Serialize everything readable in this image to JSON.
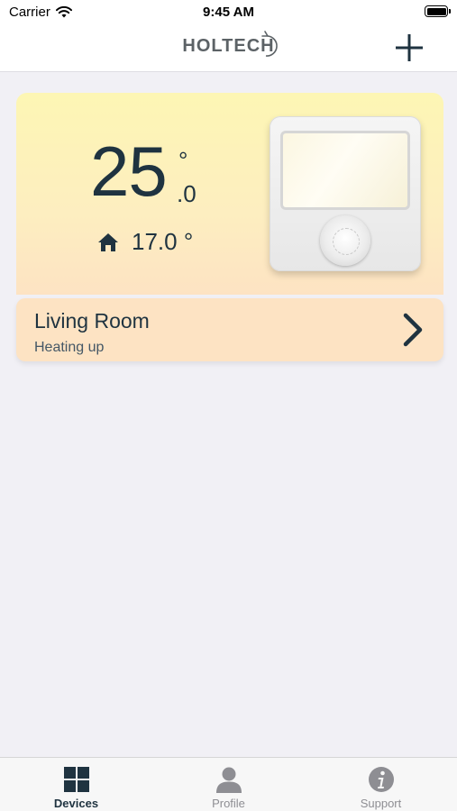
{
  "status_bar": {
    "carrier": "Carrier",
    "time": "9:45 AM"
  },
  "header": {
    "brand": "HOLTECH",
    "add_icon": "plus-icon"
  },
  "device": {
    "temperature_whole": "25",
    "temperature_degree": "°",
    "temperature_decimal": ".0",
    "indoor_temperature": "17.0 °",
    "room_name": "Living Room",
    "status": "Heating up",
    "card_gradient_top": "#fdf6b4",
    "card_gradient_bottom": "#fde3c3"
  },
  "tabs": [
    {
      "label": "Devices",
      "icon": "grid-icon",
      "active": true
    },
    {
      "label": "Profile",
      "icon": "person-icon",
      "active": false
    },
    {
      "label": "Support",
      "icon": "info-icon",
      "active": false
    }
  ],
  "colors": {
    "primary": "#1f3340",
    "inactive": "#8e8e93",
    "background": "#f1f0f5"
  }
}
